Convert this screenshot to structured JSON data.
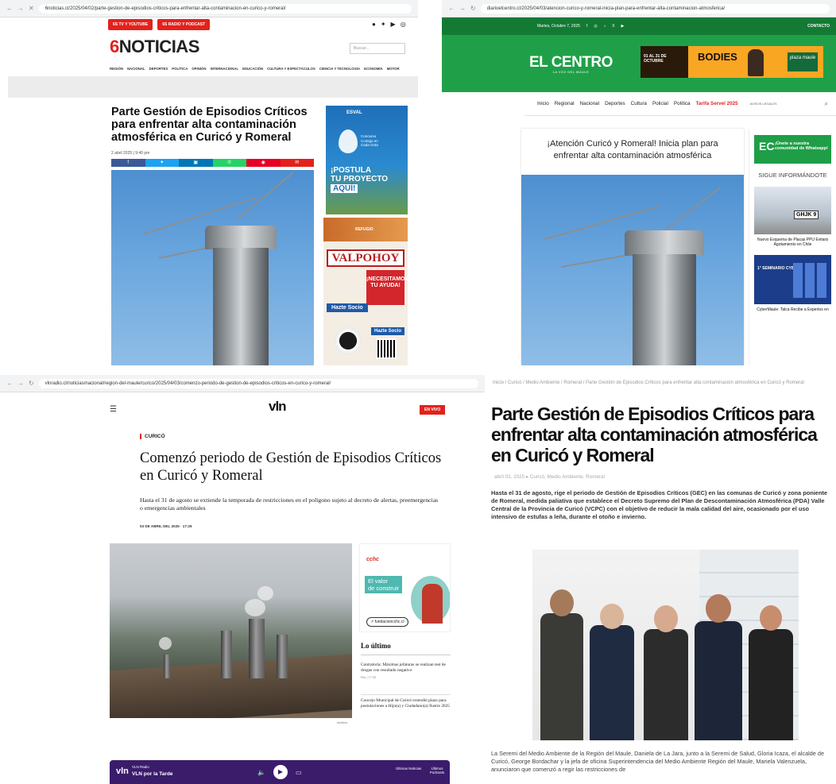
{
  "p1": {
    "url": "6noticias.cl/2025/04/02/parte-gestion-de-episodios-criticos-para-enfrentar-alta-contaminacion-en-curico-y-romeral/",
    "top_buttons": [
      "6S TV Y YOUTUBE",
      "6S RADIO Y PODCAST"
    ],
    "logo": "NOTICIAS",
    "search_placeholder": "Buscar...",
    "menu": [
      "REGIÓN",
      "NACIONAL",
      "DEPORTES",
      "POLÍTICA",
      "OPINIÓN",
      "INTERNACIONAL",
      "EDUCACIÓN",
      "CULTURA Y ESPECTÁCULOS",
      "CIENCIA Y TECNOLOGÍA",
      "ECONOMÍA",
      "MOTOR"
    ],
    "headline": "Parte Gestión de Episodios Críticos para enfrentar alta contaminación atmosférica en Curicó y Romeral",
    "date": "2 abril 2025 | 9:40 pm",
    "share_colors": [
      "#3b5998",
      "#1da1f2",
      "#0077b5",
      "#25d366",
      "#e60023",
      "#e3211c"
    ],
    "ad1": {
      "brand": "ESVAL",
      "small": "Concurso Contigo en Cada Gota",
      "big1": "¡POSTULA",
      "big2": "TU PROYECTO",
      "aqui": "AQUÍ!"
    },
    "ad2": {
      "refugio": "REFUGIO",
      "valpo": "VALPOHOY",
      "help": "¡NECESITAMOS TU AYUDA!",
      "hazte": "Hazte Socio",
      "hazte2": "Hazte Socio"
    }
  },
  "p2": {
    "url": "diarioelcentro.cl/2025/04/03/atencion-curico-y-romeral-inicia-plan-para-enfrentar-alta-contaminacion-atmosferica/",
    "date": "Martes, Octubre 7, 2025",
    "contacto": "CONTACTO",
    "logo": "EL CENTRO",
    "logo_sub": "LA VOZ DEL MAULE",
    "banner": {
      "left": "01 AL 31 DE OCTUBRE",
      "middle": "BODIES",
      "right": "plaza maule"
    },
    "nav": [
      "Inicio",
      "Regional",
      "Nacional",
      "Deportes",
      "Cultura",
      "Policial",
      "Política"
    ],
    "nav_highlight": "Tarifa Servel 2025",
    "legal": "AVISOS LEGALES",
    "title": "¡Atención Curicó y Romeral! Inicia plan para enfrentar alta contaminación atmosférica",
    "whatsapp": "¡Únete a nuestra comunidad de Whatsapp!",
    "sigue": "SIGUE INFORMÁNDOTE",
    "plate": "GHJK 9",
    "cap1": "Nuevo Esquema de Placas PPU Evitará Agotamiento en Chile",
    "seminario": "1° SEMINARIO CYBERMAULE",
    "cap2": "CyberMaule: Talca Recibe a Expertos en"
  },
  "p3": {
    "url": "vlnradio.cl/noticias/nacional/region-del-maule/curico/2025/04/03/comenzo-periodo-de-gestion-de-episodios-criticos-en-curico-y-romeral/",
    "logo": "vln",
    "envivo": "EN VIVO",
    "category": "CURICÓ",
    "headline": "Comenzó periodo de Gestión de Episodios Críticos en Curicó y Romeral",
    "lead": "Hasta el 31 de agosto se extiende la temporada de restricciones en el polígono sujeto al decreto de alertas, preemergencias o emergencias ambientales",
    "meta": "03 DE ABRIL DEL 2025 · 17:25",
    "photo_caption": "Archivo",
    "ad": {
      "brand": "cchc",
      "valor1": "El valor",
      "valor2": "de construir",
      "btn": "fundacioncchc.cl"
    },
    "lo_ultimo": "Lo último",
    "news": [
      {
        "title": "Contraloría: Máximas jefaturas se realizan test de drogas con resultado negativo",
        "time": "Hoy | 17:40"
      },
      {
        "title": "Concejo Municipal de Curicó extendió plazo para postulaciones a Hijo(a) y Ciudadano(a) Ilustre 2025",
        "time": ""
      }
    ],
    "player": {
      "radio": "VLN Radio",
      "program": "VLN por la Tarde",
      "ul1": "Últimas Noticias",
      "ul2": "Últimos Podcasts"
    }
  },
  "p4": {
    "breadcrumb": "Inicio / Curicó / Medio Ambiente / Romeral / Parte Gestión de Episodios Críticos para enfrentar alta contaminación atmosférica en Curicó y Romeral",
    "headline": "Parte Gestión de Episodios Críticos para enfrentar alta contaminación atmosférica en Curicó y Romeral",
    "meta": "abril 02, 2025  ▸ Curicó, Medio Ambiente, Romeral",
    "lead": "Hasta el 31 de agosto, rige el periodo de Gestión de Episodios Críticos (GEC) en las comunas de Curicó y zona poniente de Romeral, medida paliativa que establece el Decreto Supremo del Plan de Descontaminación Atmosférica (PDA) Valle Central de la Provincia de Curicó (VCPC) con el objetivo de reducir la mala calidad del aire, ocasionado por el uso intensivo de estufas a leña, durante el otoño e invierno.",
    "body": "La Seremi del Medio Ambiente de la Región del Maule, Daniela de La Jara, junto a la Seremi de Salud, Gloria Icaza, el alcalde de Curicó, George Bordachar y la jefa de oficina Superintendencia del Medio Ambiente Región del Maule, Mariela Valenzuela, anunciaron que comenzó a regir las restricciones de"
  }
}
